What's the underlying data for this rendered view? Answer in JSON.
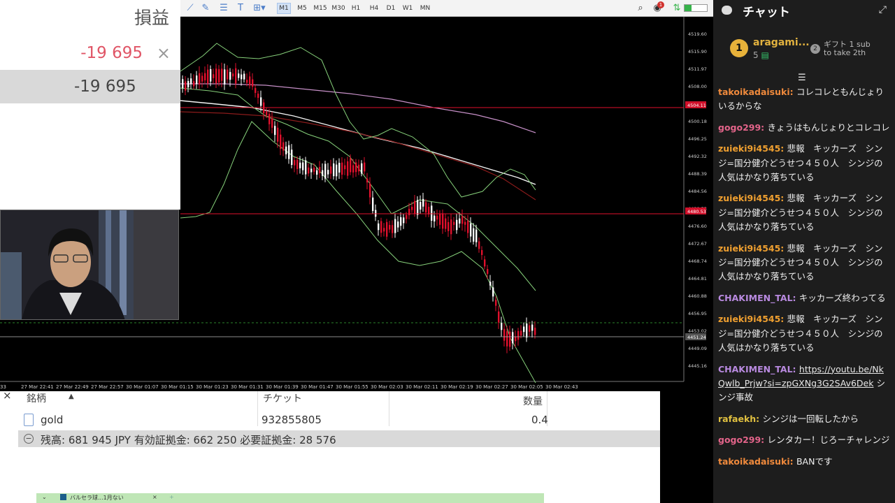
{
  "toolbar": {
    "timeframes": [
      "M1",
      "M5",
      "M15",
      "M30",
      "H1",
      "H4",
      "D1",
      "W1",
      "MN"
    ],
    "active_timeframe": "M1",
    "notification_count": "1"
  },
  "chart": {
    "price_labels": [
      "4519.60",
      "4515.90",
      "4511.97",
      "4508.00",
      "4504.11",
      "4500.18",
      "4496.25",
      "4492.32",
      "4488.39",
      "4484.56",
      "4480.53",
      "4476.60",
      "4472.67",
      "4468.74",
      "4464.81",
      "4460.88",
      "4456.95",
      "4453.02",
      "4449.09",
      "4445.16"
    ],
    "red_price_tag_1": "4504.11",
    "red_price_tag_2": "4480.53",
    "gray_price_tag": "4451.24",
    "time_labels": [
      "33",
      "27 Mar 22:41",
      "27 Mar 22:49",
      "27 Mar 22:57",
      "30 Mar 01:07",
      "30 Mar 01:15",
      "30 Mar 01:23",
      "30 Mar 01:31",
      "30 Mar 01:39",
      "30 Mar 01:47",
      "30 Mar 01:55",
      "30 Mar 02:03",
      "30 Mar 02:11",
      "30 Mar 02:19",
      "30 Mar 02:27",
      "30 Mar 02:05",
      "30 Mar 02:43"
    ],
    "colors": {
      "bull": "#ffffff",
      "bear": "#e0102c",
      "band": "#86d07a",
      "ma_white": "#f5f5f5",
      "ma_pink": "#c790c8",
      "ma_red": "#8a1b1b",
      "hline": "#e0102c"
    }
  },
  "pl_panel": {
    "title": "損益",
    "value_red": "-19 695",
    "close_icon": "×",
    "value_total": "-19 695"
  },
  "terminal": {
    "headers": {
      "symbol": "銘柄",
      "ticket": "チケット",
      "volume": "数量"
    },
    "row": {
      "symbol": "gold",
      "ticket": "932855805",
      "volume": "0.4"
    },
    "summary": "残高: 681 945 JPY  有効証拠金: 662 250  必要証拠金: 28 576"
  },
  "tabstrip": {
    "tab_label": "バルセラ球...1月ない",
    "icons": [
      "⌄",
      "×",
      "+"
    ]
  },
  "chat": {
    "title": "チャット",
    "gift": {
      "rank": "1",
      "user": "aragami...",
      "count": "5",
      "text_line1": "ギフト 1 sub",
      "text_line2": "to take 2th",
      "icon_num": "2"
    },
    "messages": [
      {
        "user": "takoikadaisuki",
        "color": "#f08a3c",
        "text": "コレコレともんじょりいるからな"
      },
      {
        "user": "gogo299",
        "color": "#e3648a",
        "text": "きょうはもんじょりとコレコレ"
      },
      {
        "user": "zuieki9i4545",
        "color": "#f0a030",
        "text": "悲報　キッカーズ　シンジ=国分健介どうせつ４５０人　シンジの人気はかなり落ちている"
      },
      {
        "user": "zuieki9i4545",
        "color": "#f0a030",
        "text": "悲報　キッカーズ　シンジ=国分健介どうせつ４５０人　シンジの人気はかなり落ちている"
      },
      {
        "user": "zuieki9i4545",
        "color": "#f0a030",
        "text": "悲報　キッカーズ　シンジ=国分健介どうせつ４５０人　シンジの人気はかなり落ちている"
      },
      {
        "user": "CHAKIMEN_TAL",
        "color": "#b98ae0",
        "text": "キッカーズ終わってる"
      },
      {
        "user": "zuieki9i4545",
        "color": "#f0a030",
        "text": "悲報　キッカーズ　シンジ=国分健介どうせつ４５０人　シンジの人気はかなり落ちている"
      },
      {
        "user": "CHAKIMEN_TAL",
        "color": "#b98ae0",
        "text": "",
        "link": "https://youtu.be/NkQwlb_Prjw?si=zpGXNg3G2SAv6Dek",
        "after": " シンジ事故"
      },
      {
        "user": "rafaekh",
        "color": "#e0c040",
        "text": "シンジは一回転したから"
      },
      {
        "user": "gogo299",
        "color": "#e3648a",
        "text": "レンタカー！じろーチャレンジ"
      },
      {
        "user": "takoikadaisuki",
        "color": "#f08a3c",
        "text": "BANです"
      }
    ]
  }
}
